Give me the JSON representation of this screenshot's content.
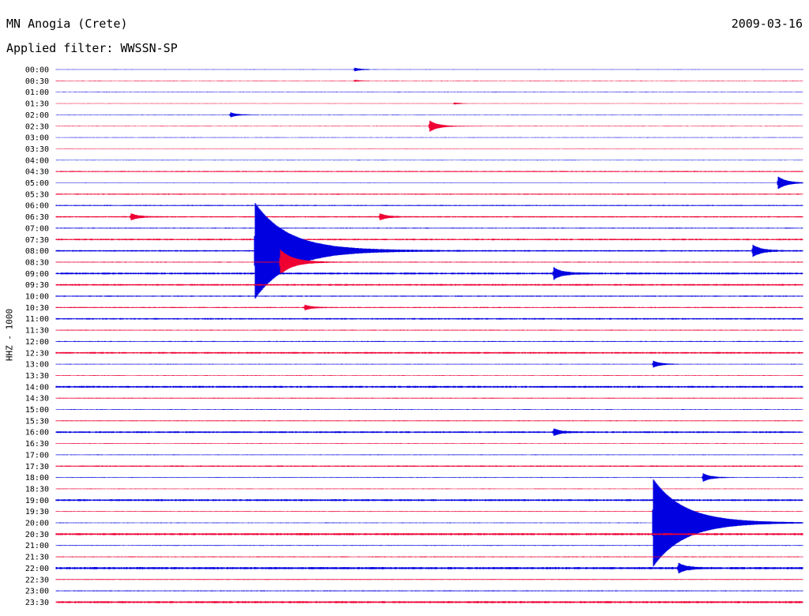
{
  "header": {
    "station": "MN Anogia (Crete)",
    "date": "2009-03-16",
    "filter": "Applied filter: WWSSN-SP"
  },
  "colors": {
    "trace_a": "#0000e0",
    "trace_b": "#ee0033"
  },
  "chart_data": {
    "type": "line",
    "title": "MN Anogia (Crete)",
    "subtitle": "Applied filter: WWSSN-SP",
    "ylabel": "HHZ - 1000",
    "xlabel": "",
    "grid": false,
    "row_labels": [
      "00:00",
      "00:30",
      "01:00",
      "01:30",
      "02:00",
      "02:30",
      "03:00",
      "03:30",
      "04:00",
      "04:30",
      "05:00",
      "05:30",
      "06:00",
      "06:30",
      "07:00",
      "07:30",
      "08:00",
      "08:30",
      "09:00",
      "09:30",
      "10:00",
      "10:30",
      "11:00",
      "11:30",
      "12:00",
      "12:30",
      "13:00",
      "13:30",
      "14:00",
      "14:30",
      "15:00",
      "15:30",
      "16:00",
      "16:30",
      "17:00",
      "17:30",
      "18:00",
      "18:30",
      "19:00",
      "19:30",
      "20:00",
      "20:30",
      "21:00",
      "21:30",
      "22:00",
      "22:30",
      "23:00",
      "23:30"
    ],
    "row_noise": [
      0.3,
      0.3,
      0.3,
      0.3,
      0.3,
      0.3,
      0.3,
      0.3,
      0.3,
      0.6,
      0.3,
      0.6,
      0.6,
      0.7,
      0.5,
      0.8,
      0.8,
      0.5,
      1.0,
      0.9,
      0.6,
      0.6,
      0.8,
      0.5,
      0.5,
      0.9,
      0.4,
      0.4,
      1.0,
      0.5,
      0.4,
      0.5,
      0.9,
      0.4,
      0.4,
      0.7,
      0.4,
      0.4,
      1.0,
      0.4,
      0.4,
      1.1,
      0.4,
      0.5,
      1.2,
      0.5,
      0.5,
      1.1
    ],
    "events": [
      {
        "row": 0,
        "minute": 12,
        "amp": 2
      },
      {
        "row": 1,
        "minute": 12,
        "amp": 1
      },
      {
        "row": 3,
        "minute": 16,
        "amp": 1
      },
      {
        "row": 4,
        "minute": 7,
        "amp": 3
      },
      {
        "row": 5,
        "minute": 15,
        "amp": 7
      },
      {
        "row": 10,
        "minute": 29,
        "amp": 8
      },
      {
        "row": 13,
        "minute": 3,
        "amp": 4
      },
      {
        "row": 13,
        "minute": 13,
        "amp": 4
      },
      {
        "row": 16,
        "minute": 8,
        "amp": 60
      },
      {
        "row": 16,
        "minute": 28,
        "amp": 7
      },
      {
        "row": 17,
        "minute": 9,
        "amp": 16
      },
      {
        "row": 18,
        "minute": 20,
        "amp": 7
      },
      {
        "row": 21,
        "minute": 10,
        "amp": 3
      },
      {
        "row": 26,
        "minute": 24,
        "amp": 4
      },
      {
        "row": 32,
        "minute": 20,
        "amp": 4
      },
      {
        "row": 36,
        "minute": 26,
        "amp": 5
      },
      {
        "row": 40,
        "minute": 24,
        "amp": 55
      },
      {
        "row": 44,
        "minute": 25,
        "amp": 6
      }
    ]
  }
}
